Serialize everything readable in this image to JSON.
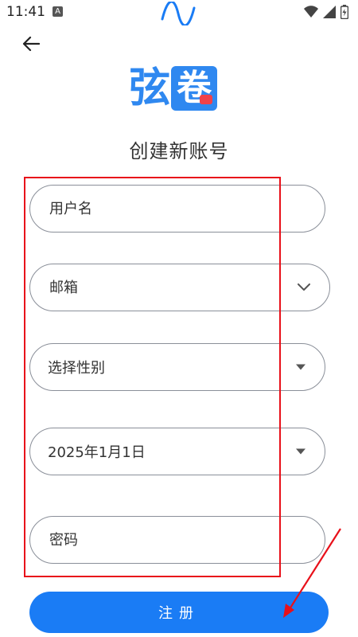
{
  "status_bar": {
    "time": "11:41",
    "notif_icon": "A"
  },
  "logo": {
    "char1": "弦",
    "char2": "卷"
  },
  "page": {
    "title": "创建新账号"
  },
  "form": {
    "username_placeholder": "用户名",
    "email_placeholder": "邮箱",
    "gender_placeholder": "选择性别",
    "birthdate_value": "2025年1月1日",
    "password_placeholder": "密码"
  },
  "submit": {
    "label": "注册"
  },
  "colors": {
    "primary": "#1a7cf5",
    "annotation": "#e8101a",
    "logo_red": "#f0424a"
  }
}
